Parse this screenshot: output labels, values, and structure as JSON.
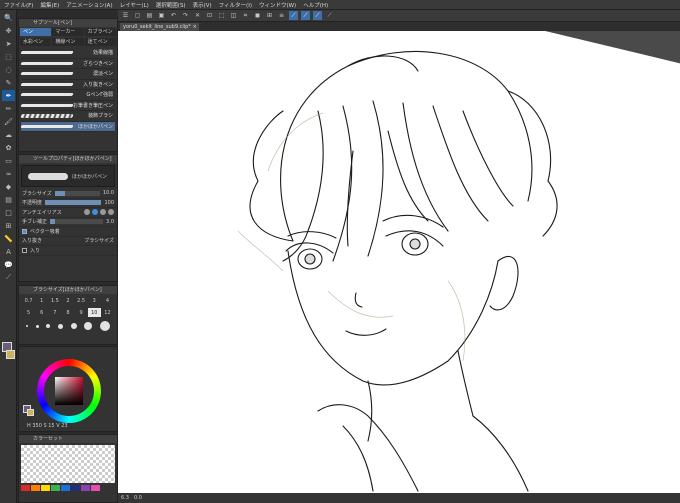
{
  "menu": {
    "items": [
      "ファイル(F)",
      "編集(E)",
      "アニメーション(A)",
      "レイヤー(L)",
      "選択範囲(S)",
      "表示(V)",
      "フィルター(I)",
      "ウィンドウ(W)",
      "ヘルプ(H)"
    ]
  },
  "subtool": {
    "title": "サブツール[ペン]",
    "tabs": [
      "ペン",
      "マーカー",
      "カブラペン",
      "水彩ペン",
      "横線ペン",
      "迷てペン"
    ],
    "brushes": [
      "効果線描",
      "ざらつきペン",
      "濃淡ペン",
      "入り抜きペン",
      "GペンΓ強弱",
      "お筆書き筆圧ペン",
      "装飾ブラシ",
      "ほかほかパペン"
    ]
  },
  "toolprop": {
    "title": "ツールプロパティ[ほかほかパペン]",
    "preview_label": "ほかほかパペン",
    "brush_size_label": "ブラシサイズ",
    "brush_size_value": "10.0",
    "opacity_label": "不透明度",
    "opacity_value": "100",
    "antialias_label": "アンチエイリアス",
    "stabilization_label": "手ブレ補正",
    "stabilization_value": "3.0",
    "vector_label": "ベクター吸着",
    "inout_label": "入り抜き",
    "inout_value": "ブラシサイズ",
    "in_label": "入り"
  },
  "brushsize": {
    "title": "ブラシサイズ[ほかほかパペン]",
    "sizes": [
      "0.7",
      "1",
      "1.5",
      "2",
      "2.5",
      "3",
      "4",
      "5",
      "6",
      "7",
      "8",
      "9",
      "10",
      "12"
    ],
    "selected": "10"
  },
  "colorwheel": {
    "hsv": "H 350  S 15  V 23"
  },
  "colorset": {
    "title": "カラーセット",
    "colors": [
      "#d62b2b",
      "#ff7f00",
      "#ffd800",
      "#3cb44b",
      "#1e6fdc",
      "#1f2f7a",
      "#8e3fb2",
      "#e84fb0",
      "#333333"
    ]
  },
  "document": {
    "tab_label": "yoru0_sekit_line_sub9.clip*",
    "close": "×"
  },
  "status": {
    "zoom": "6.3",
    "angle": "0.0"
  },
  "colors": {
    "main_color": "#6a5e7a",
    "sub_color": "#c9b35a",
    "accent": "#3f6fa8"
  }
}
